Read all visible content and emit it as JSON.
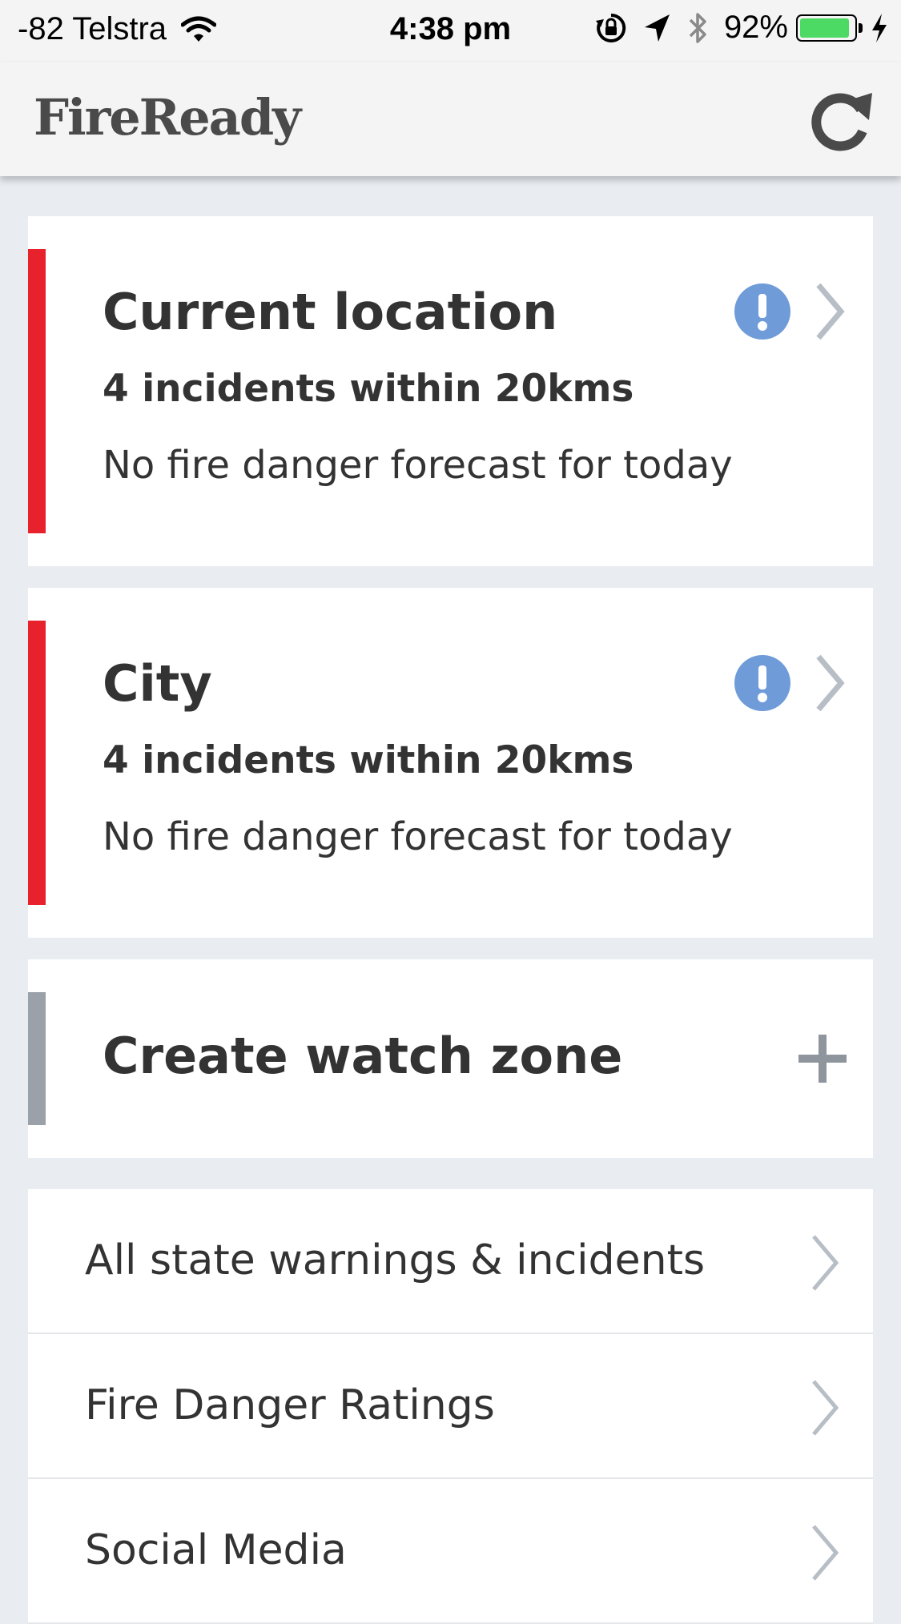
{
  "status_bar": {
    "carrier": "-82 Telstra",
    "time": "4:38 pm",
    "battery_percent": "92%",
    "battery_level": 0.92,
    "icons": [
      "wifi-icon",
      "orientation-lock-icon",
      "location-arrow-icon",
      "bluetooth-icon",
      "battery-icon",
      "charging-bolt-icon"
    ]
  },
  "app_bar": {
    "logo": "FireReady",
    "refresh_icon": "refresh-icon"
  },
  "watch_zones": [
    {
      "title": "Current location",
      "incidents": "4 incidents within 20kms",
      "forecast": "No fire danger forecast for today",
      "stripe_color": "#e8222d",
      "alert_icon": "info-alert-icon"
    },
    {
      "title": "City",
      "incidents": "4 incidents within 20kms",
      "forecast": "No fire danger forecast for today",
      "stripe_color": "#e8222d",
      "alert_icon": "info-alert-icon"
    }
  ],
  "create_zone": {
    "label": "Create watch zone",
    "stripe_color": "#9aa1a8",
    "icon": "plus-icon"
  },
  "menu": [
    {
      "label": "All state warnings & incidents"
    },
    {
      "label": "Fire Danger Ratings"
    },
    {
      "label": "Social Media"
    }
  ],
  "colors": {
    "background": "#e9ecf0",
    "alert_red": "#e8222d",
    "info_blue": "#6f9bd9",
    "chevron_grey": "#b8bec6"
  }
}
